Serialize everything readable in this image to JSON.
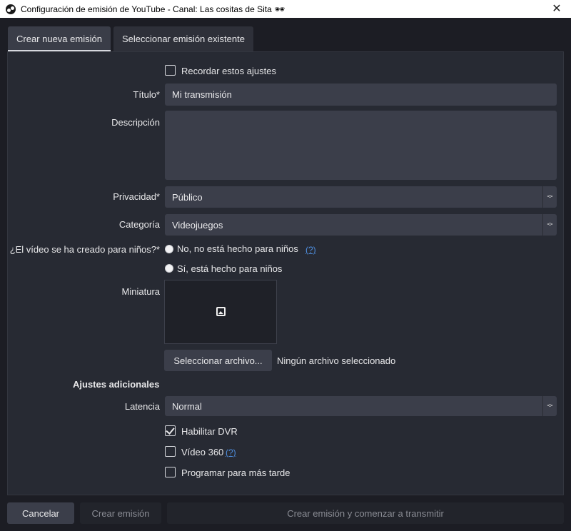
{
  "window": {
    "title": "Configuración de emisión de YouTube - Canal: Las cositas de Sita 🕶",
    "close": "✕"
  },
  "tabs": [
    {
      "label": "Crear nueva emisión",
      "active": true
    },
    {
      "label": "Seleccionar emisión existente",
      "active": false
    }
  ],
  "form": {
    "remember_label": "Recordar estos ajustes",
    "remember_checked": false,
    "title_label": "Título*",
    "title_value": "Mi transmisión",
    "description_label": "Descripción",
    "description_value": "",
    "privacy_label": "Privacidad*",
    "privacy_value": "Público",
    "category_label": "Categoría",
    "category_value": "Videojuegos",
    "kids_label": "¿El vídeo se ha creado para niños?*",
    "kids_no_label": "No, no está hecho para niños",
    "kids_yes_label": "Sí, está hecho para niños",
    "help_link": "(?)",
    "thumbnail_label": "Miniatura",
    "select_file_button": "Seleccionar archivo...",
    "no_file_text": "Ningún archivo seleccionado",
    "additional_heading": "Ajustes adicionales",
    "latency_label": "Latencia",
    "latency_value": "Normal",
    "dvr_label": "Habilitar DVR",
    "dvr_checked": true,
    "video360_label": "Vídeo 360",
    "video360_checked": false,
    "schedule_label": "Programar para más tarde",
    "schedule_checked": false
  },
  "footer": {
    "cancel": "Cancelar",
    "create": "Crear emisión",
    "create_and_start": "Crear emisión y comenzar a transmitir"
  },
  "icons": {
    "app": "obs-icon",
    "thumbnail": "image-icon",
    "select": "updown-chevron-icon"
  },
  "colors": {
    "background": "#1c1d24",
    "panel": "#272a33",
    "field": "#3b3e4a",
    "link": "#4f8fe0"
  }
}
